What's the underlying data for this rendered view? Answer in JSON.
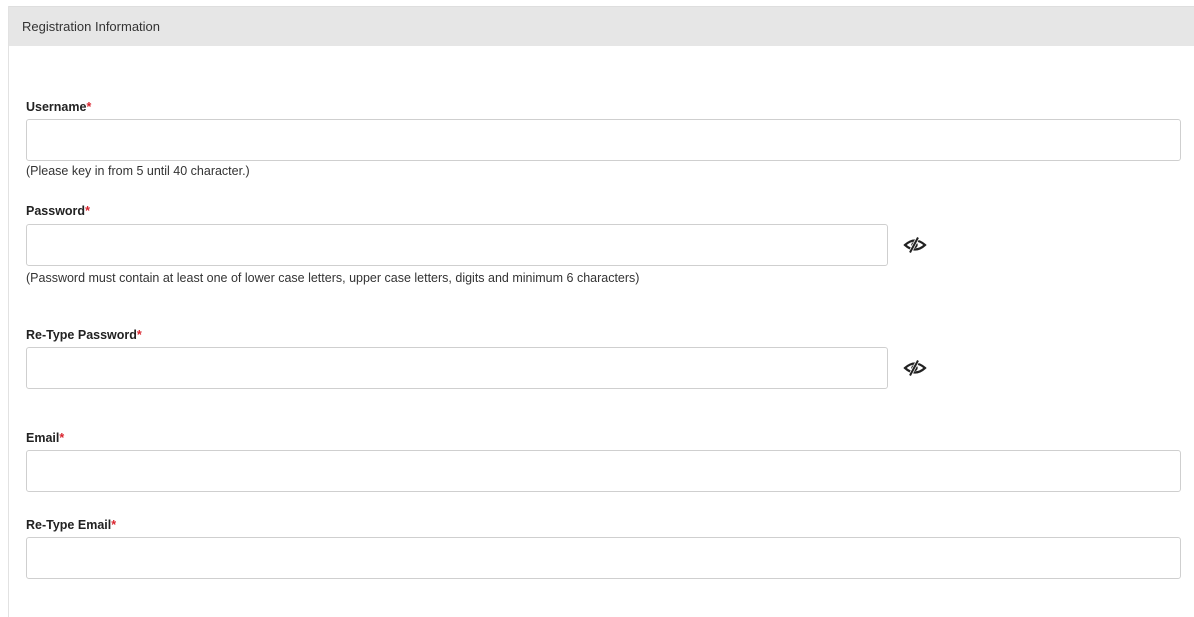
{
  "panel": {
    "title": "Registration Information"
  },
  "form": {
    "required_marker": "*",
    "username": {
      "label": "Username",
      "value": "",
      "placeholder": "",
      "hint": "(Please key in from 5 until 40 character.)"
    },
    "password": {
      "label": "Password",
      "value": "",
      "placeholder": "",
      "hint": "(Password must contain at least one of lower case letters, upper case letters, digits and minimum 6 characters)",
      "toggle_icon": "eye-slash-icon"
    },
    "retype_password": {
      "label": "Re-Type Password",
      "value": "",
      "placeholder": "",
      "toggle_icon": "eye-slash-icon"
    },
    "email": {
      "label": "Email",
      "value": "",
      "placeholder": ""
    },
    "retype_email": {
      "label": "Re-Type Email",
      "value": "",
      "placeholder": ""
    }
  },
  "colors": {
    "required": "#d9232d",
    "header_bg": "#e6e6e6",
    "input_border": "#cfcfcf"
  }
}
